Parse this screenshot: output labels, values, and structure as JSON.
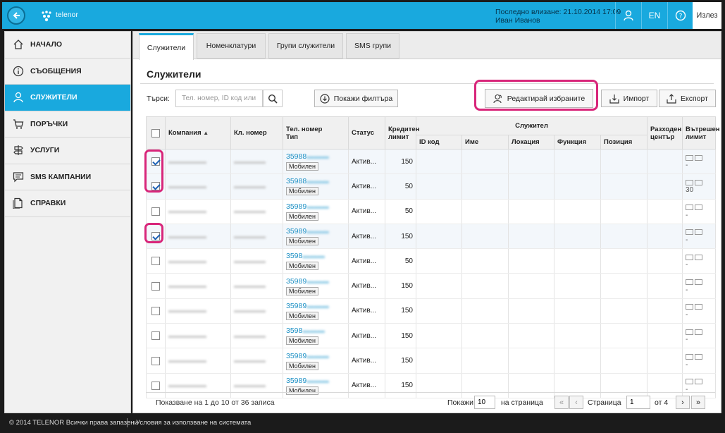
{
  "header": {
    "brand": "telenor",
    "last_login": "Последно влизане: 21.10.2014 17:09",
    "user_name": "Иван Иванов",
    "lang": "EN",
    "logout": "Излез"
  },
  "sidebar": {
    "items": [
      {
        "label": "НАЧАЛО",
        "icon": "home-icon",
        "active": false
      },
      {
        "label": "СЪОБЩЕНИЯ",
        "icon": "info-icon",
        "active": false
      },
      {
        "label": "СЛУЖИТЕЛИ",
        "icon": "user-icon",
        "active": true
      },
      {
        "label": "ПОРЪЧКИ",
        "icon": "cart-icon",
        "active": false
      },
      {
        "label": "УСЛУГИ",
        "icon": "signpost-icon",
        "active": false
      },
      {
        "label": "SMS КАМПАНИИ",
        "icon": "chat-icon",
        "active": false
      },
      {
        "label": "СПРАВКИ",
        "icon": "document-icon",
        "active": false
      }
    ]
  },
  "tabs": [
    "Служители",
    "Номенклатури",
    "Групи служители",
    "SMS групи"
  ],
  "page_title": "Служители",
  "toolbar": {
    "search_label": "Търси:",
    "search_placeholder": "Тел. номер, ID код или и",
    "filters_label": "Покажи филтъра",
    "edit_selected_label": "Редактирай избраните",
    "import_label": "Импорт",
    "export_label": "Експорт"
  },
  "table": {
    "headers": {
      "company": "Компания",
      "client_no": "Кл. номер",
      "phone": "Тел. номер",
      "phone_sub": "Тип",
      "status": "Статус",
      "credit_limit": "Кредитен лимит",
      "employee_group": "Служител",
      "id_code": "ID код",
      "name": "Име",
      "location": "Локация",
      "function": "Функция",
      "position": "Позиция",
      "cost_center": "Разходен център",
      "internal_limit": "Вътрешен лимит"
    },
    "rows": [
      {
        "checked": true,
        "phone": "35988",
        "type": "Мобилен",
        "status": "Актив...",
        "limit": "150",
        "internal": "-"
      },
      {
        "checked": true,
        "phone": "35988",
        "type": "Мобилен",
        "status": "Актив...",
        "limit": "50",
        "internal": "30"
      },
      {
        "checked": false,
        "phone": "35989",
        "type": "Мобилен",
        "status": "Актив...",
        "limit": "50",
        "internal": "-"
      },
      {
        "checked": true,
        "phone": "35989",
        "type": "Мобилен",
        "status": "Актив...",
        "limit": "150",
        "internal": "-"
      },
      {
        "checked": false,
        "phone": "3598",
        "type": "Мобилен",
        "status": "Актив...",
        "limit": "50",
        "internal": "-"
      },
      {
        "checked": false,
        "phone": "35989",
        "type": "Мобилен",
        "status": "Актив...",
        "limit": "150",
        "internal": "-"
      },
      {
        "checked": false,
        "phone": "35989",
        "type": "Мобилен",
        "status": "Актив...",
        "limit": "150",
        "internal": "-"
      },
      {
        "checked": false,
        "phone": "3598",
        "type": "Мобилен",
        "status": "Актив...",
        "limit": "150",
        "internal": "-"
      },
      {
        "checked": false,
        "phone": "35989",
        "type": "Мобилен",
        "status": "Актив...",
        "limit": "150",
        "internal": "-"
      },
      {
        "checked": false,
        "phone": "35989",
        "type": "Мобилен",
        "status": "Актив...",
        "limit": "150",
        "internal": "-"
      }
    ]
  },
  "pagination": {
    "records_info": "Показване на 1 до 10 от 36 записа",
    "show_label": "Покажи",
    "page_size": "10",
    "per_page_label": "на страница",
    "page_label": "Страница",
    "page_value": "1",
    "of_label": "от 4"
  },
  "footer": {
    "copyright": "© 2014 TELENOR Всички права запазени",
    "terms": "Условия за използване на системата"
  },
  "colors": {
    "accent": "#19a9de",
    "highlight": "#d8267a",
    "link": "#1a8fc4"
  }
}
